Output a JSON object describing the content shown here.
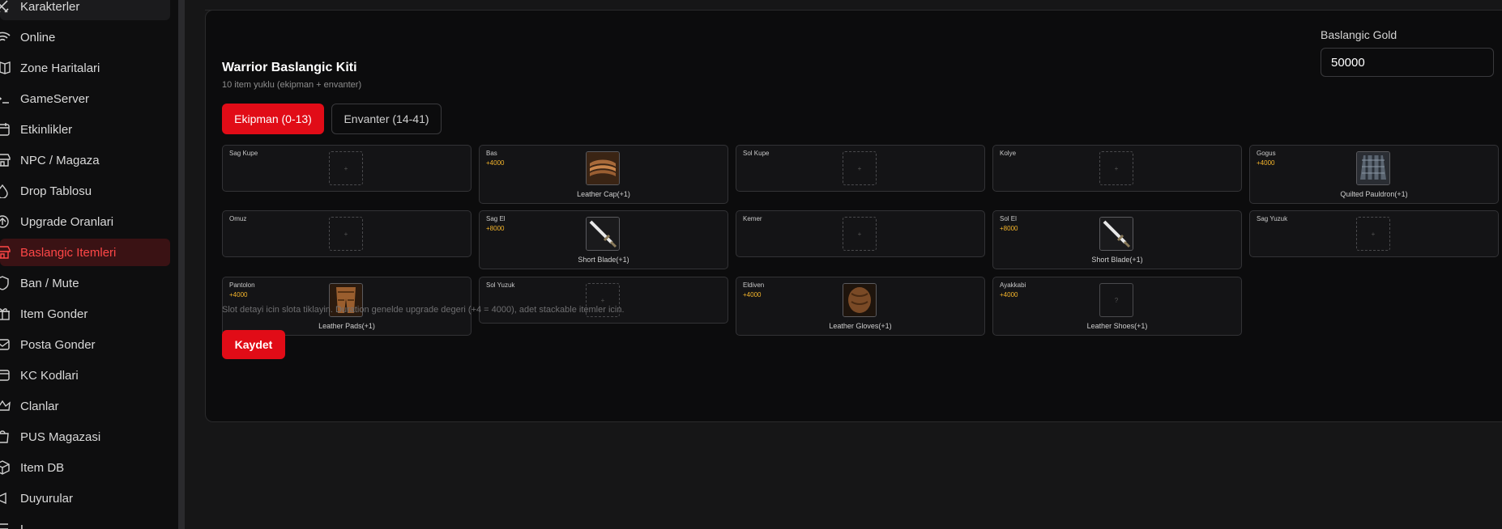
{
  "sidebar": {
    "items": [
      {
        "label": "Karakterler",
        "icon": "swords-icon"
      },
      {
        "label": "Online",
        "icon": "wifi-icon"
      },
      {
        "label": "Zone Haritalari",
        "icon": "map-icon"
      },
      {
        "label": "GameServer",
        "icon": "terminal-icon"
      },
      {
        "label": "Etkinlikler",
        "icon": "calendar-icon"
      },
      {
        "label": "NPC / Magaza",
        "icon": "store-icon"
      },
      {
        "label": "Drop Tablosu",
        "icon": "droplet-icon"
      },
      {
        "label": "Upgrade Oranlari",
        "icon": "upgrade-icon"
      },
      {
        "label": "Baslangic Itemleri",
        "icon": "store-icon",
        "active": true
      },
      {
        "label": "Ban / Mute",
        "icon": "shield-icon"
      },
      {
        "label": "Item Gonder",
        "icon": "gift-icon"
      },
      {
        "label": "Posta Gonder",
        "icon": "mail-icon"
      },
      {
        "label": "KC Kodlari",
        "icon": "card-icon"
      },
      {
        "label": "Clanlar",
        "icon": "crown-icon"
      },
      {
        "label": "PUS Magazasi",
        "icon": "bag-icon"
      },
      {
        "label": "Item DB",
        "icon": "box-icon"
      },
      {
        "label": "Duyurular",
        "icon": "megaphone-icon"
      },
      {
        "label": "L...",
        "icon": "log-icon"
      }
    ]
  },
  "kit": {
    "title": "Warrior Baslangic Kiti",
    "subtitle": "10 item yuklu (ekipman + envanter)",
    "gold_label": "Baslangic Gold",
    "gold_value": "50000",
    "tabs": [
      {
        "label": "Ekipman (0-13)",
        "active": true
      },
      {
        "label": "Envanter (14-41)",
        "active": false
      }
    ],
    "hint": "Slot detayi icin slota tiklayin. Duration genelde upgrade degeri (+4 = 4000), adet stackable itemler icin.",
    "save_label": "Kaydet"
  },
  "slots": [
    {
      "name": "Sag Kupe",
      "plus": "",
      "item": "",
      "placeholder": "+"
    },
    {
      "name": "Bas",
      "plus": "+4000",
      "item": "Leather Cap(+1)"
    },
    {
      "name": "Sol Kupe",
      "plus": "",
      "item": "",
      "placeholder": "+"
    },
    {
      "name": "Kolye",
      "plus": "",
      "item": "",
      "placeholder": "+"
    },
    {
      "name": "Gogus",
      "plus": "+4000",
      "item": "Quilted Pauldron(+1)"
    },
    {
      "name": "Omuz",
      "plus": "",
      "item": "",
      "placeholder": "+"
    },
    {
      "name": "Sag El",
      "plus": "+8000",
      "item": "Short Blade(+1)"
    },
    {
      "name": "Kemer",
      "plus": "",
      "item": "",
      "placeholder": "+"
    },
    {
      "name": "Sol El",
      "plus": "+8000",
      "item": "Short Blade(+1)"
    },
    {
      "name": "Sag Yuzuk",
      "plus": "",
      "item": "",
      "placeholder": "+"
    },
    {
      "name": "Pantolon",
      "plus": "+4000",
      "item": "Leather Pads(+1)"
    },
    {
      "name": "Sol Yuzuk",
      "plus": "",
      "item": "",
      "placeholder": "+"
    },
    {
      "name": "Eldiven",
      "plus": "+4000",
      "item": "Leather Gloves(+1)"
    },
    {
      "name": "Ayakkabi",
      "plus": "+4000",
      "item": "Leather Shoes(+1)",
      "unknown_glyph": "?"
    }
  ],
  "colors": {
    "accent": "#e10c17",
    "plus": "#f5b52b"
  }
}
